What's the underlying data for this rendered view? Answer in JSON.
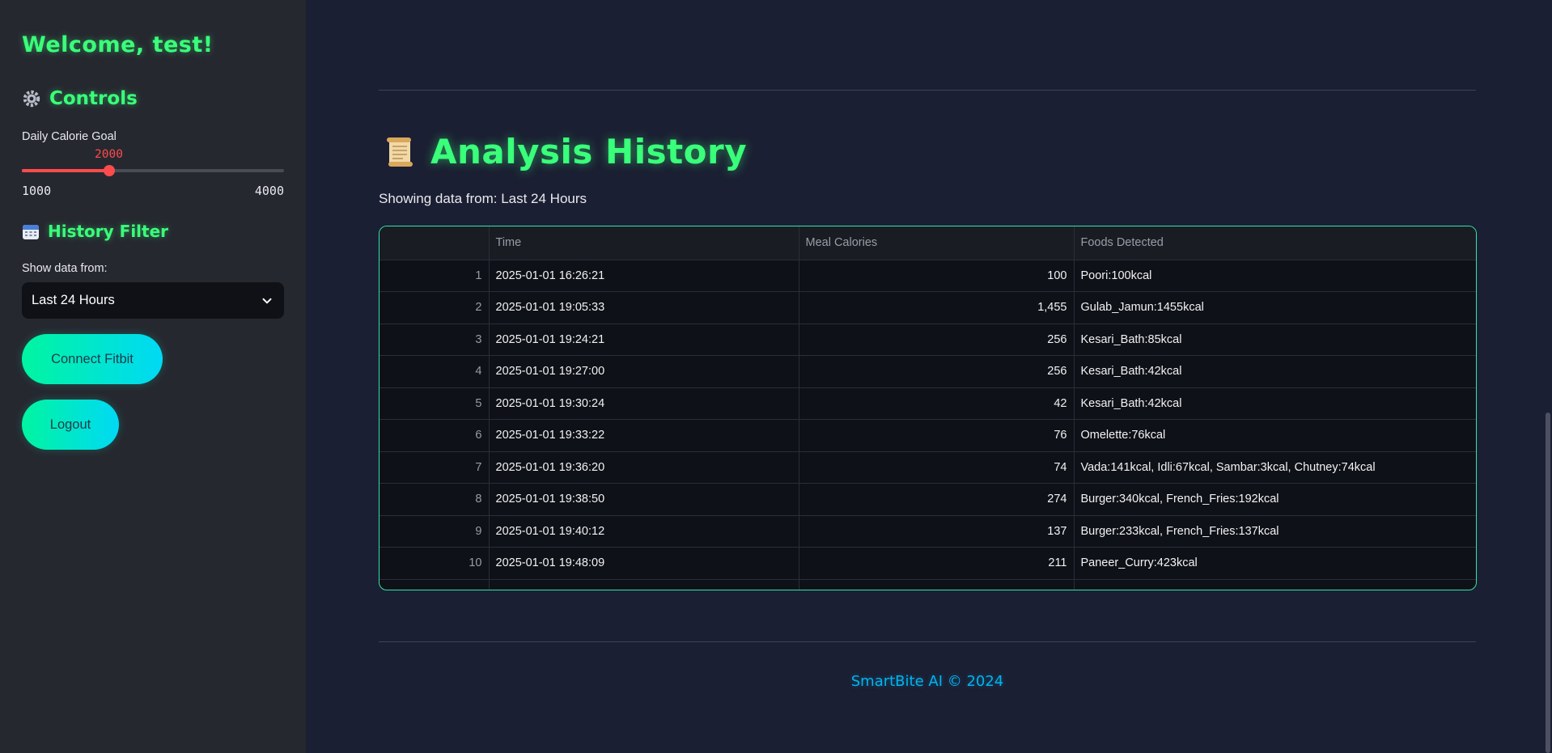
{
  "sidebar": {
    "welcome": "Welcome, test!",
    "controls_heading": "Controls",
    "goal_label": "Daily Calorie Goal",
    "slider": {
      "value": "2000",
      "min": "1000",
      "max": "4000",
      "fraction": 0.3333
    },
    "history_heading": "History Filter",
    "show_label": "Show data from:",
    "select_value": "Last 24 Hours",
    "connect_button": "Connect Fitbit",
    "logout_button": "Logout"
  },
  "main": {
    "title": "Analysis History",
    "showing": "Showing data from: Last 24 Hours",
    "table": {
      "columns": [
        "",
        "Time",
        "Meal Calories",
        "Foods Detected"
      ],
      "rows": [
        {
          "idx": "1",
          "time": "2025-01-01 16:26:21",
          "calories": "100",
          "foods": "Poori:100kcal"
        },
        {
          "idx": "2",
          "time": "2025-01-01 19:05:33",
          "calories": "1,455",
          "foods": "Gulab_Jamun:1455kcal"
        },
        {
          "idx": "3",
          "time": "2025-01-01 19:24:21",
          "calories": "256",
          "foods": "Kesari_Bath:85kcal"
        },
        {
          "idx": "4",
          "time": "2025-01-01 19:27:00",
          "calories": "256",
          "foods": "Kesari_Bath:42kcal"
        },
        {
          "idx": "5",
          "time": "2025-01-01 19:30:24",
          "calories": "42",
          "foods": "Kesari_Bath:42kcal"
        },
        {
          "idx": "6",
          "time": "2025-01-01 19:33:22",
          "calories": "76",
          "foods": "Omelette:76kcal"
        },
        {
          "idx": "7",
          "time": "2025-01-01 19:36:20",
          "calories": "74",
          "foods": "Vada:141kcal, Idli:67kcal, Sambar:3kcal, Chutney:74kcal"
        },
        {
          "idx": "8",
          "time": "2025-01-01 19:38:50",
          "calories": "274",
          "foods": "Burger:340kcal, French_Fries:192kcal"
        },
        {
          "idx": "9",
          "time": "2025-01-01 19:40:12",
          "calories": "137",
          "foods": "Burger:233kcal, French_Fries:137kcal"
        },
        {
          "idx": "10",
          "time": "2025-01-01 19:48:09",
          "calories": "211",
          "foods": "Paneer_Curry:423kcal"
        }
      ]
    }
  },
  "footer": "SmartBite AI © 2024",
  "colors": {
    "accent_green": "#39ff7a",
    "slider_red": "#ff4b4b",
    "button_gradient_start": "#00f5a0",
    "button_gradient_end": "#00d9f5",
    "footer_blue": "#00b4f0"
  }
}
